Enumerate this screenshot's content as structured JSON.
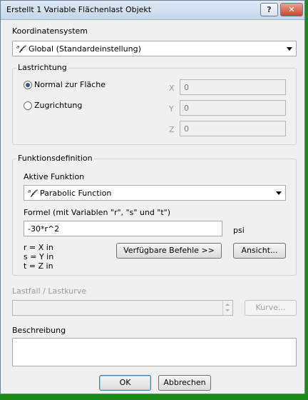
{
  "window": {
    "title": "Erstellt 1 Variable Flächenlast Objekt",
    "help_label": "?",
    "close_label": "✕"
  },
  "koordinaten": {
    "label": "Koordinatensystem",
    "icon_glyph": "ᵃ𝓯",
    "selected": "Global (Standardeinstellung)"
  },
  "lastrichtung": {
    "label": "Lastrichtung",
    "options": [
      {
        "label": "Normal zur Fläche",
        "selected": true
      },
      {
        "label": "Zugrichtung",
        "selected": false
      }
    ],
    "x": {
      "label": "X",
      "value": "0"
    },
    "y": {
      "label": "Y",
      "value": "0"
    },
    "z": {
      "label": "Z",
      "value": "0"
    }
  },
  "funktion": {
    "group_label": "Funktionsdefinition",
    "aktive_label": "Aktive Funktion",
    "icon_glyph": "ᵃ𝓯",
    "selected": "Parabolic Function",
    "formel_label": "Formel (mit Variablen \"r\", \"s\" und \"t\")",
    "formel_value": "-30*r^2",
    "unit": "psi",
    "var_r": "r = X in",
    "var_s": "s = Y in",
    "var_t": "t = Z in",
    "befehle_button": "Verfügbare Befehle >>",
    "ansicht_button": "Ansicht..."
  },
  "lastfall": {
    "label": "Lastfall / Lastkurve",
    "kurve_button": "Kurve..."
  },
  "beschreibung": {
    "label": "Beschreibung",
    "value": ""
  },
  "footer": {
    "ok_label": "OK",
    "cancel_label": "Abbrechen"
  }
}
